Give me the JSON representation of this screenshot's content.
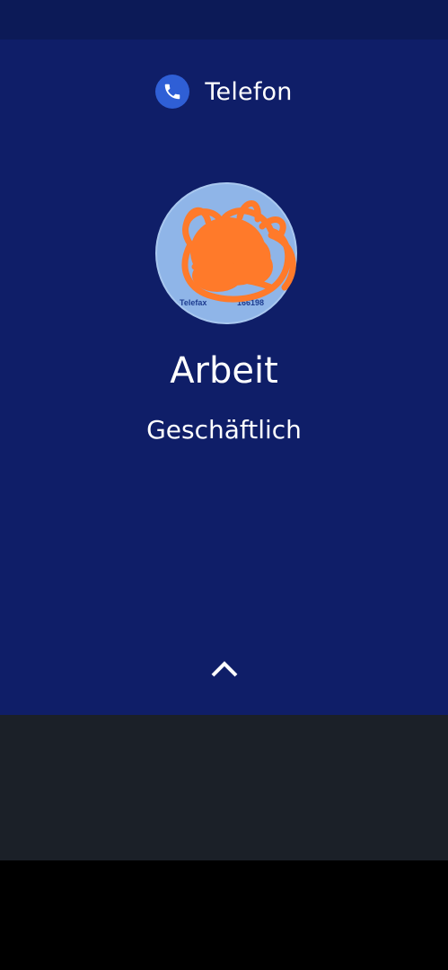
{
  "app": {
    "name": "Telefon",
    "icon": "phone-icon",
    "icon_color": "#2f5fd6"
  },
  "call": {
    "caller_name": "Arbeit",
    "caller_label": "Geschäftlich",
    "avatar_partial_text": "Telefax",
    "avatar_partial_number": "166198",
    "swipe_icon": "chevron-up-icon"
  },
  "colors": {
    "call_background": "#0f1e68",
    "status_bar": "#0c1a57",
    "bottom_area": "#1b2028",
    "scribble": "#ff7a2a"
  }
}
